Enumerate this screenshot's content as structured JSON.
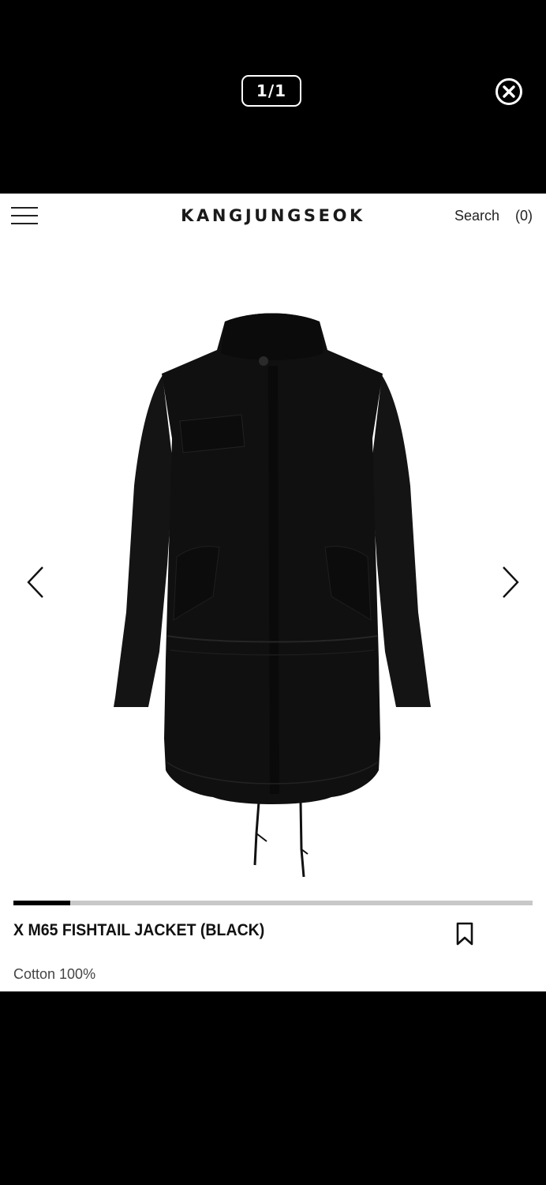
{
  "viewer": {
    "page_counter": "1/1",
    "close_icon": "close-circle-icon"
  },
  "header": {
    "menu_icon": "hamburger-menu-icon",
    "brand": "KANGJUNGSEOK",
    "search_label": "Search",
    "cart_label": "(0)"
  },
  "gallery": {
    "image_alt": "black M65 fishtail jacket",
    "prev_icon": "chevron-left-icon",
    "next_icon": "chevron-right-icon",
    "progress_fraction": 0.11
  },
  "product": {
    "title": "X M65 FISHTAIL JACKET (BLACK)",
    "bookmark_icon": "bookmark-icon",
    "material": "Cotton 100%"
  },
  "colors": {
    "viewer_background": "#000000",
    "page_background": "#ffffff",
    "jacket": "#111111",
    "progress_track": "#c8c8c8",
    "progress_fill": "#000000"
  }
}
